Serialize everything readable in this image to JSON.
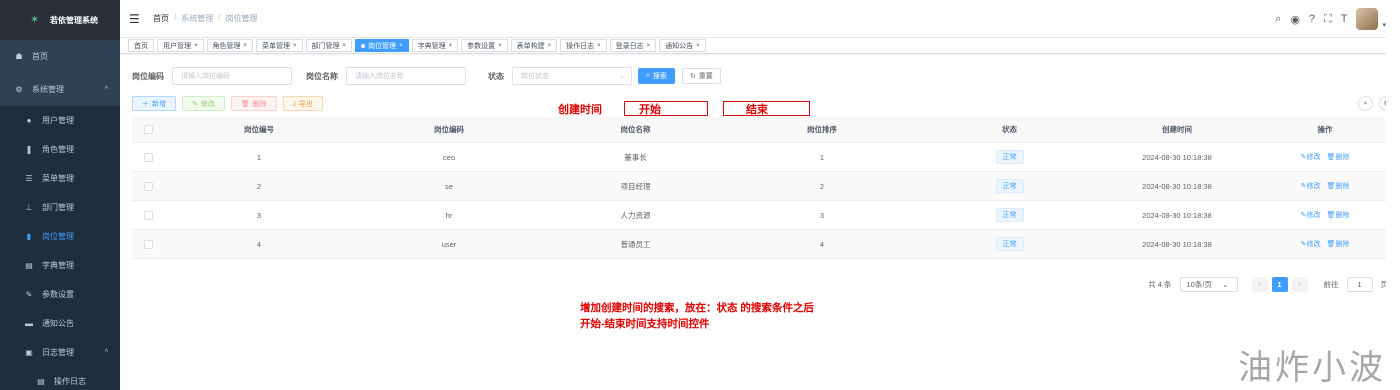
{
  "app": {
    "title": "若依管理系统"
  },
  "sidebar": {
    "items": [
      {
        "label": "首页",
        "icon": "dashboard-icon",
        "glyph": "☗"
      },
      {
        "label": "系统管理",
        "icon": "gear-icon",
        "glyph": "⚙"
      },
      {
        "label": "用户管理",
        "icon": "user-icon",
        "glyph": "●"
      },
      {
        "label": "角色管理",
        "icon": "peoples-icon",
        "glyph": "❚"
      },
      {
        "label": "菜单管理",
        "icon": "tree-table-icon",
        "glyph": "☰"
      },
      {
        "label": "部门管理",
        "icon": "tree-icon",
        "glyph": "⊥"
      },
      {
        "label": "岗位管理",
        "icon": "post-icon",
        "glyph": "▮"
      },
      {
        "label": "字典管理",
        "icon": "dict-icon",
        "glyph": "▤"
      },
      {
        "label": "参数设置",
        "icon": "edit-icon",
        "glyph": "✎"
      },
      {
        "label": "通知公告",
        "icon": "message-icon",
        "glyph": "▬"
      },
      {
        "label": "日志管理",
        "icon": "log-icon",
        "glyph": "▣"
      },
      {
        "label": "操作日志",
        "icon": "form-icon",
        "glyph": "▤"
      }
    ]
  },
  "breadcrumb": {
    "home": "首页",
    "parent": "系统管理",
    "current": "岗位管理"
  },
  "tags": [
    "首页",
    "用户管理",
    "角色管理",
    "菜单管理",
    "部门管理",
    "岗位管理",
    "字典管理",
    "参数设置",
    "表单构建",
    "操作日志",
    "登录日志",
    "通知公告"
  ],
  "search": {
    "post_code_label": "岗位编码",
    "post_code_placeholder": "请输入岗位编码",
    "post_name_label": "岗位名称",
    "post_name_placeholder": "请输入岗位名称",
    "status_label": "状态",
    "status_placeholder": "岗位状态",
    "search_button": "搜索",
    "reset_button": "重置"
  },
  "toolbar": {
    "add": "新增",
    "edit": "修改",
    "delete": "删除",
    "export": "导出"
  },
  "annotations": {
    "created_time": "创建时间",
    "start": "开始",
    "end": "结束",
    "note_line1": "增加创建时间的搜索，放在：状态 的搜索条件之后",
    "note_line2": "开始-结束时间支持时间控件"
  },
  "table": {
    "columns": [
      "岗位编号",
      "岗位编码",
      "岗位名称",
      "岗位排序",
      "状态",
      "创建时间",
      "操作"
    ],
    "rows": [
      {
        "id": "1",
        "code": "ceo",
        "name": "董事长",
        "sort": "1",
        "status": "正常",
        "created": "2024-08-30 10:18:38"
      },
      {
        "id": "2",
        "code": "se",
        "name": "项目经理",
        "sort": "2",
        "status": "正常",
        "created": "2024-08-30 10:18:38"
      },
      {
        "id": "3",
        "code": "hr",
        "name": "人力资源",
        "sort": "3",
        "status": "正常",
        "created": "2024-08-30 10:18:38"
      },
      {
        "id": "4",
        "code": "user",
        "name": "普通员工",
        "sort": "4",
        "status": "正常",
        "created": "2024-08-30 10:18:38"
      }
    ],
    "op_edit": "修改",
    "op_delete": "删除"
  },
  "pagination": {
    "total": "共 4 条",
    "page_size": "10条/页",
    "current_page": "1",
    "goto_label": "前往",
    "goto_value": "1",
    "page_suffix": "页"
  },
  "watermark": "油炸小波",
  "colors": {
    "primary": "#409eff",
    "sidebar": "#304156",
    "annotation": "#e00000"
  }
}
